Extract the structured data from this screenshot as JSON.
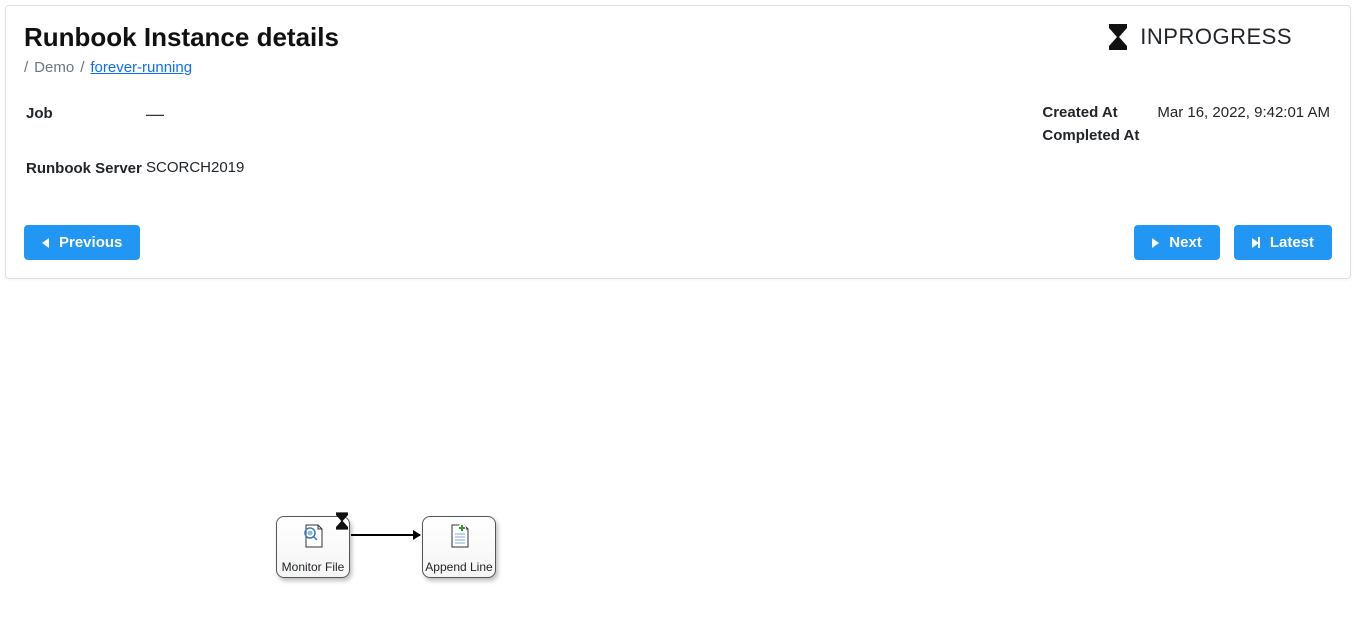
{
  "header": {
    "title": "Runbook Instance details",
    "breadcrumb": {
      "parent": "Demo",
      "current": "forever-running"
    },
    "status": "INPROGRESS"
  },
  "details": {
    "job_label": "Job",
    "job_value": "—",
    "server_label": "Runbook Server",
    "server_value": "SCORCH2019",
    "created_label": "Created At",
    "created_value": "Mar 16, 2022, 9:42:01 AM",
    "completed_label": "Completed At",
    "completed_value": ""
  },
  "buttons": {
    "previous": "Previous",
    "next": "Next",
    "latest": "Latest"
  },
  "workflow": {
    "node1_label": "Monitor File",
    "node2_label": "Append Line"
  }
}
